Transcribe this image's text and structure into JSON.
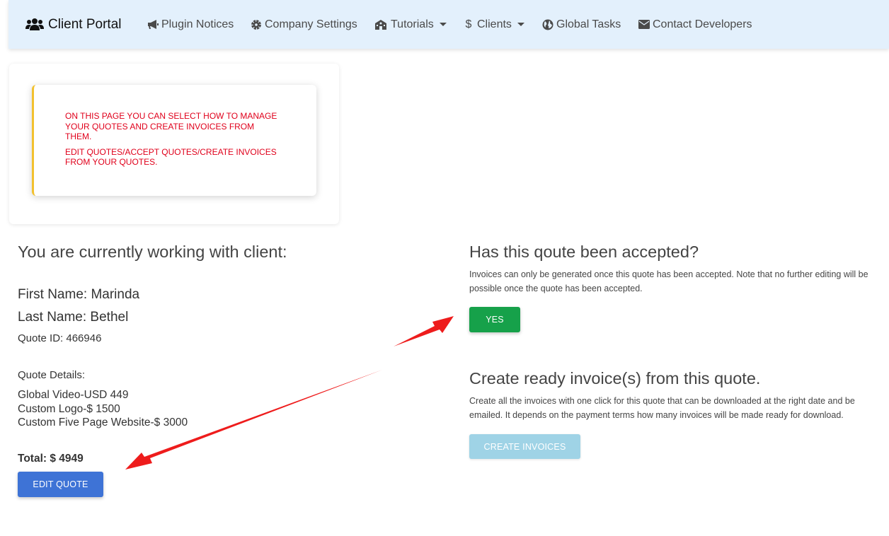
{
  "navbar": {
    "brand": {
      "icon": "users-icon",
      "label": "Client Portal"
    },
    "items": [
      {
        "icon": "megaphone-icon",
        "label": "Plugin Notices",
        "dropdown": false
      },
      {
        "icon": "gear-icon",
        "label": "Company Settings",
        "dropdown": false
      },
      {
        "icon": "school-icon",
        "label": "Tutorials",
        "dropdown": true
      },
      {
        "icon": "dollar-icon",
        "label": "Clients",
        "dropdown": true
      },
      {
        "icon": "globe-icon",
        "label": "Global Tasks",
        "dropdown": false
      },
      {
        "icon": "envelope-icon",
        "label": "Contact Developers",
        "dropdown": false
      }
    ]
  },
  "notice": {
    "line1": "ON THIS PAGE YOU CAN SELECT HOW TO MANAGE YOUR QUOTES AND CREATE INVOICES FROM THEM.",
    "line2": "EDIT QUOTES/ACCEPT QUOTES/CREATE INVOICES FROM YOUR QUOTES."
  },
  "client": {
    "heading": "You are currently working with client:",
    "first_name": "First Name: Marinda",
    "last_name": "Last Name: Bethel",
    "quote_id": "Quote ID: 466946",
    "details_label": "Quote Details:",
    "details": [
      "Global Video-USD 449",
      "Custom Logo-$ 1500",
      "Custom Five Page Website-$ 3000"
    ],
    "total": "Total: $ 4949",
    "edit_button": "EDIT QUOTE"
  },
  "accept": {
    "heading": "Has this qoute been accepted?",
    "text": "Invoices can only be generated once this quote has been accepted. Note that no further editing will be possible once the quote has been accepted.",
    "button": "YES"
  },
  "invoice": {
    "heading": "Create ready invoice(s) from this quote.",
    "text": "Create all the invoices with one click for this quote that can be downloaded at the right date and be emailed. It depends on the payment terms how many invoices will be made ready for download.",
    "button": "CREATE INVOICES"
  },
  "colors": {
    "navbar_bg": "#e3f0fc",
    "notice_text": "#e0001b",
    "notice_accent": "#f2c12e",
    "edit_button": "#3e73d6",
    "yes_button": "#16a14a",
    "create_button": "#9fd3e6",
    "annotation_arrow": "#ee1c1c"
  }
}
